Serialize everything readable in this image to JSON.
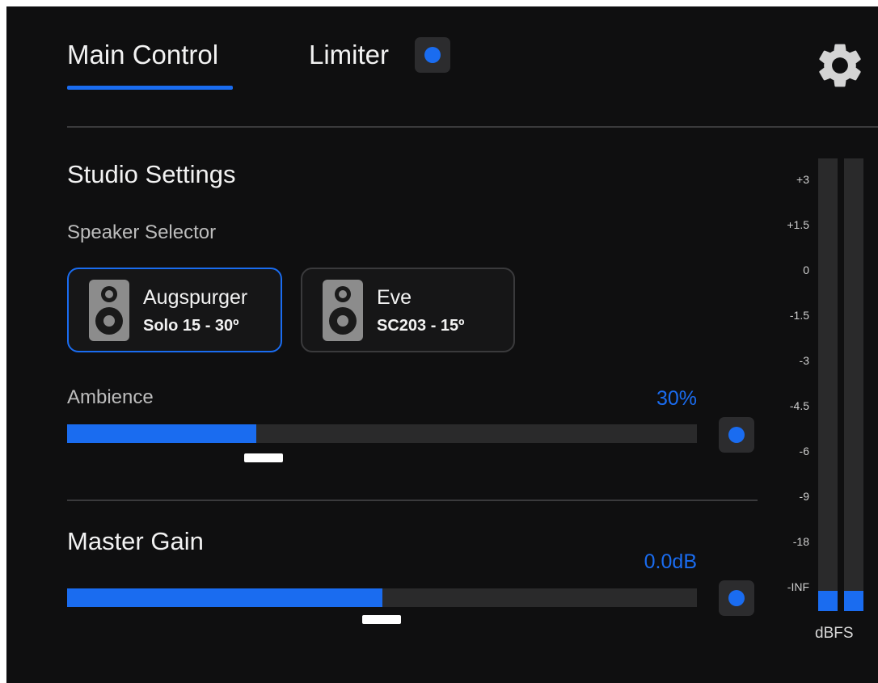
{
  "tabs": [
    {
      "label": "Main Control",
      "active": true
    },
    {
      "label": "Limiter",
      "active": false
    }
  ],
  "limiter": {
    "enabled": true
  },
  "icons": {
    "settings": "gear-icon",
    "speaker": "speaker-icon"
  },
  "studio": {
    "title": "Studio Settings",
    "speaker_selector_label": "Speaker Selector",
    "speakers": [
      {
        "name": "Augspurger",
        "model": "Solo 15 - 30º",
        "selected": true
      },
      {
        "name": "Eve",
        "model": "SC203 - 15º",
        "selected": false
      }
    ],
    "ambience": {
      "label": "Ambience",
      "value_text": "30%",
      "fraction": 0.3,
      "enabled": true
    }
  },
  "master_gain": {
    "title": "Master Gain",
    "value_text": "0.0dB",
    "fraction": 0.5,
    "enabled": true
  },
  "meter": {
    "scale": [
      "+3",
      "+1.5",
      "0",
      "-1.5",
      "-3",
      "-4.5",
      "-6",
      "-9",
      "-18",
      "-INF"
    ],
    "unit": "dBFS",
    "levels": [
      0.045,
      0.045
    ]
  },
  "colors": {
    "accent": "#1a6cf0",
    "background": "#0f0f10",
    "track": "#2a2a2b"
  }
}
